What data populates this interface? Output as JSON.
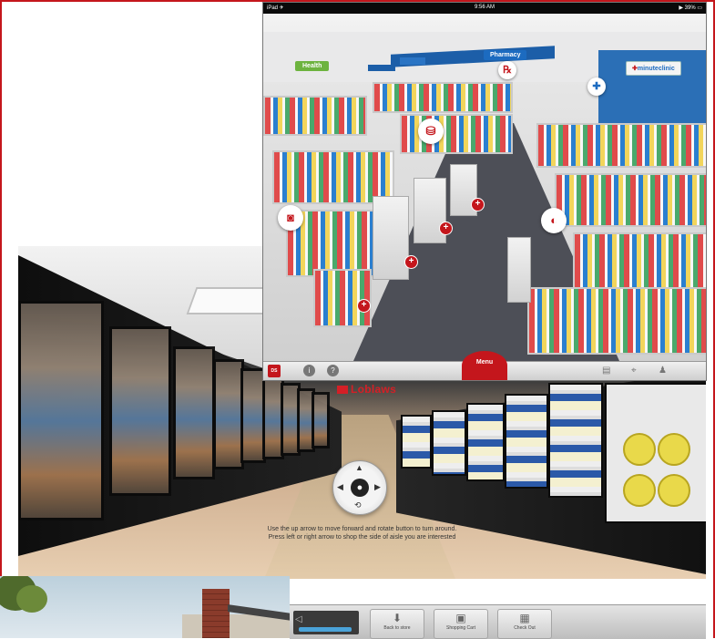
{
  "ipad_app": {
    "status_bar": {
      "carrier": "iPad ✈",
      "time": "9:56 AM",
      "battery": "▶ 39% ▭"
    },
    "signs": {
      "health": "Health",
      "pharmacy": "Pharmacy",
      "minute_clinic": "minuteclinic"
    },
    "bottom_bar": {
      "logo": "DS",
      "menu_label": "Menu"
    }
  },
  "aisle_view": {
    "store_logo": "Loblaws",
    "instructions": [
      "Use the up arrow to move forward and rotate button to turn around.",
      "Press left or right arrow to shop the side of aisle you are interested"
    ]
  },
  "toolbar": {
    "buttons": [
      {
        "label": "Back to store",
        "icon": "down-arrow-icon"
      },
      {
        "label": "Shopping Cart",
        "icon": "cart-icon"
      },
      {
        "label": "Check Out",
        "icon": "checkout-icon"
      }
    ]
  },
  "colors": {
    "brand_red": "#c4161c",
    "pharmacy_blue": "#1c6bc0",
    "health_green": "#6db33f"
  }
}
